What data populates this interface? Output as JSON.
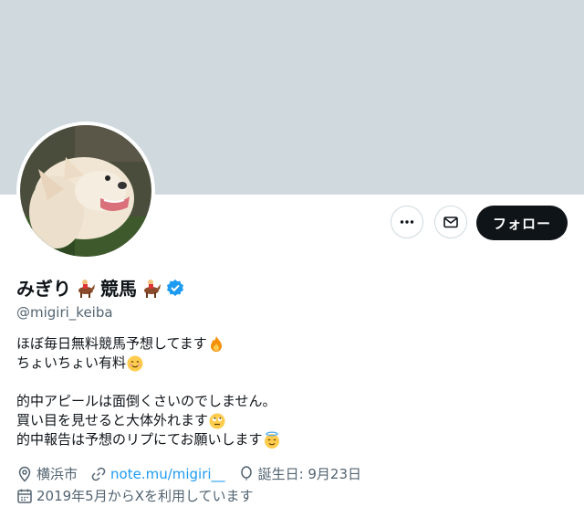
{
  "profile": {
    "display_name": "みぎり",
    "name_suffix": "競馬",
    "handle": "@migiri_keiba",
    "verified": true,
    "avatar": "chihuahua-photo"
  },
  "actions": {
    "more_label": "",
    "message_label": "",
    "follow_label": "フォロー"
  },
  "bio": {
    "line1": "ほぼ毎日無料競馬予想してます",
    "line2": "ちょいちょい有料",
    "line3": "的中アピールは面倒くさいのでしません。",
    "line4": "買い目を見せると大体外れます",
    "line5": "的中報告は予想のリプにてお願いします"
  },
  "meta": {
    "location": "横浜市",
    "link": "note.mu/migiri__",
    "birthday": "誕生日: 9月23日",
    "joined": "2019年5月からXを利用しています"
  },
  "colors": {
    "banner": "#cfd9de",
    "verified": "#1d9bf0",
    "link": "#1d9bf0",
    "follow_bg": "#0f1419",
    "secondary_text": "#536471"
  }
}
